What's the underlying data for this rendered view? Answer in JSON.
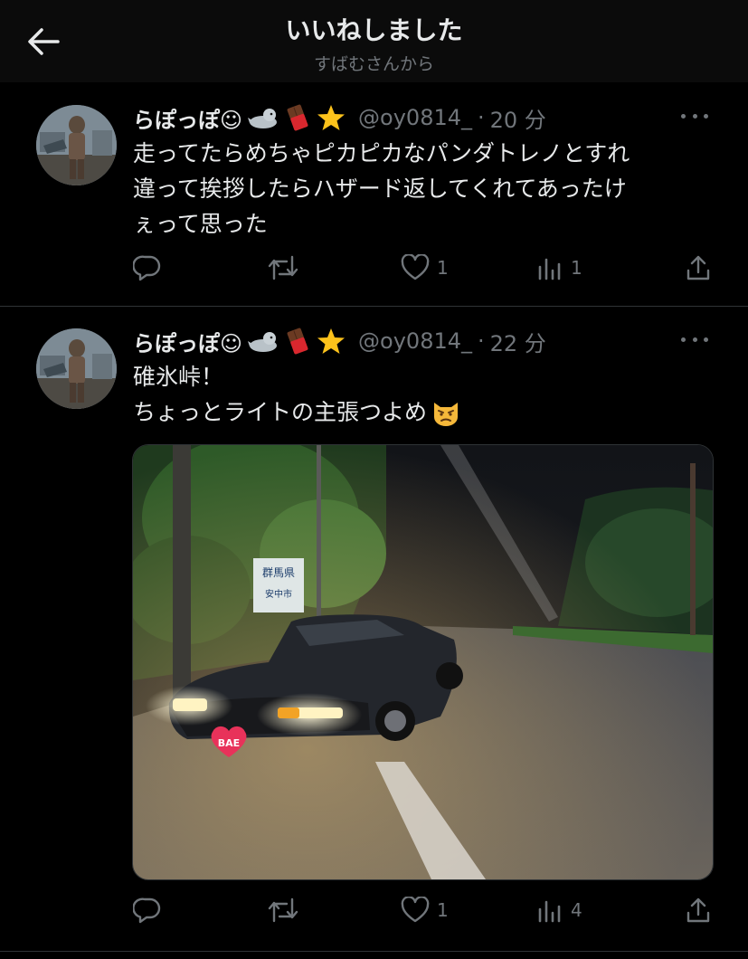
{
  "header": {
    "title": "いいねしました",
    "subtitle": "すばむさんから"
  },
  "tweets": [
    {
      "name": "らぽっぽ☺",
      "handle": "@oy0814_",
      "separator": "·",
      "time": "20 分",
      "lines": [
        "走ってたらめちゃピカピカなパンダトレノとすれ",
        "違って挨拶したらハザード返してくれてあったけ",
        "ぇって思った"
      ],
      "replies": "",
      "retweets": "",
      "likes": "1",
      "views": "1"
    },
    {
      "name": "らぽっぽ☺",
      "handle": "@oy0814_",
      "separator": "·",
      "time": "22 分",
      "lines": [
        "碓氷峠！",
        "ちょっとライトの主張つよめ"
      ],
      "replies": "",
      "retweets": "",
      "likes": "1",
      "views": "4",
      "media": {
        "sign_line1": "群馬県",
        "sign_line2": "安中市",
        "plate": "BAE"
      }
    }
  ],
  "colors": {
    "background": "#000000",
    "header_bg": "#0b0b0b",
    "text": "#e7e9ea",
    "muted": "#71767b",
    "divider": "#2f3336"
  },
  "icons": [
    "back-arrow-icon",
    "more-icon",
    "reply-icon",
    "retweet-icon",
    "like-icon",
    "views-icon",
    "share-icon",
    "seal-emoji",
    "chocolate-emoji",
    "star-emoji",
    "angry-cat-emoji"
  ]
}
